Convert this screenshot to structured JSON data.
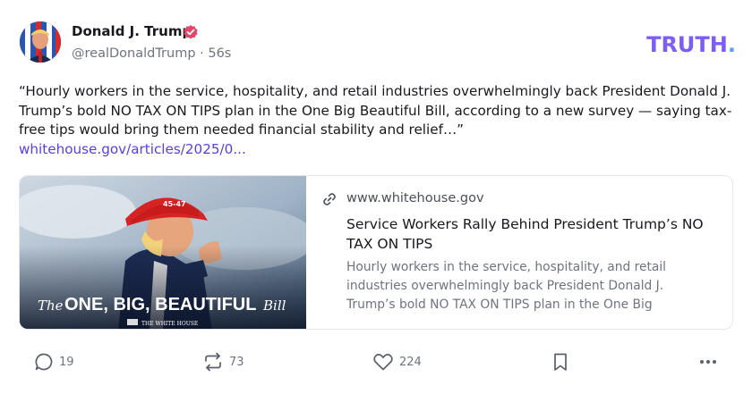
{
  "author": {
    "display_name": "Donald J. Trump",
    "handle": "@realDonaldTrump",
    "separator": "·",
    "timestamp": "56s",
    "avatar": "avatar-photo",
    "verified_icon": "verified-badge-icon"
  },
  "brand": {
    "logo_text": "TRUTH",
    "logo_dot": ".",
    "logo_colors": [
      "#7d5ef2",
      "#5f3ddc",
      "#5b9ff0"
    ]
  },
  "post": {
    "text": "“Hourly workers in the service, hospitality, and retail industries overwhelmingly back President Donald J. Trump’s bold NO TAX ON TIPS plan in the One Big Beautiful Bill, according to a new survey — saying tax-free tips would bring them needed financial stability and relief…”",
    "link_text": "whitehouse.gov/articles/2025/0..."
  },
  "link_card": {
    "domain": "www.whitehouse.gov",
    "title": "Service Workers Rally Behind President Trump’s NO TAX ON TIPS",
    "description": "Hourly workers in the service, hospitality, and retail industries overwhelmingly back President Donald J. Trump’s bold NO TAX ON TIPS plan in the One Big",
    "image": {
      "banner_prefix": "The",
      "banner_main": "ONE, BIG, BEAUTIFUL",
      "banner_suffix": "Bill",
      "hat_text": "45-47",
      "footer_text": "THE WHITE HOUSE"
    }
  },
  "actions": {
    "replies": "19",
    "retruths": "73",
    "likes": "224",
    "icons": [
      "reply-icon",
      "retruth-icon",
      "heart-icon",
      "bookmark-icon",
      "more-icon"
    ]
  },
  "colors": {
    "accent": "#5b3fd6",
    "verified": "#e0476b",
    "muted_text": "#6e7480"
  }
}
